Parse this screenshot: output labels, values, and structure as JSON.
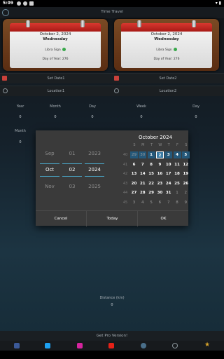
{
  "status": {
    "time": "5:09"
  },
  "app": {
    "title": "Time Travel"
  },
  "cards": [
    {
      "date": "October 2, 2024",
      "weekday": "Wednesday",
      "sign": "Libra Sign",
      "day_of_year": "Day of Year: 276"
    },
    {
      "date": "October 2, 2024",
      "weekday": "Wednesday",
      "sign": "Libra Sign",
      "day_of_year": "Day of Year: 276"
    }
  ],
  "rows": {
    "set_date1": "Set Date1",
    "set_date2": "Set Date2",
    "location1": "Location1",
    "location2": "Location2"
  },
  "diff": {
    "labels": [
      "Year",
      "Month",
      "Day",
      "Week",
      "Day"
    ],
    "values": [
      "0",
      "0",
      "0",
      "0",
      "0"
    ],
    "row2_label": "Month",
    "row2_value": "0"
  },
  "dialog": {
    "spinner": {
      "months": [
        "Sep",
        "Oct",
        "Nov"
      ],
      "days": [
        "01",
        "02",
        "03"
      ],
      "years": [
        "2023",
        "2024",
        "2025"
      ]
    },
    "calendar_title": "October 2024",
    "weekday_headers": [
      "S",
      "M",
      "T",
      "W",
      "T",
      "F",
      "S"
    ],
    "weeks": [
      {
        "wk": "40",
        "days": [
          "29",
          "30",
          "1",
          "2",
          "3",
          "4",
          "5"
        ]
      },
      {
        "wk": "41",
        "days": [
          "6",
          "7",
          "8",
          "9",
          "10",
          "11",
          "12"
        ]
      },
      {
        "wk": "42",
        "days": [
          "13",
          "14",
          "15",
          "16",
          "17",
          "18",
          "19"
        ]
      },
      {
        "wk": "43",
        "days": [
          "20",
          "21",
          "22",
          "23",
          "24",
          "25",
          "26"
        ]
      },
      {
        "wk": "44",
        "days": [
          "27",
          "28",
          "29",
          "30",
          "31",
          "1",
          "2"
        ]
      },
      {
        "wk": "45",
        "days": [
          "3",
          "4",
          "5",
          "6",
          "7",
          "8",
          "9"
        ]
      }
    ],
    "buttons": {
      "cancel": "Cancel",
      "today": "Today",
      "ok": "OK"
    }
  },
  "distance": {
    "label": "Distance (km)",
    "value": "0"
  },
  "pro_button": "Get Pro Version!",
  "social_icons": [
    "facebook-icon",
    "twitter-icon",
    "instagram-icon",
    "youtube-icon",
    "globe-icon",
    "share-icon",
    "star-icon"
  ],
  "colors": {
    "accent": "#3d7da6",
    "calendar_red": "#c9413b"
  }
}
